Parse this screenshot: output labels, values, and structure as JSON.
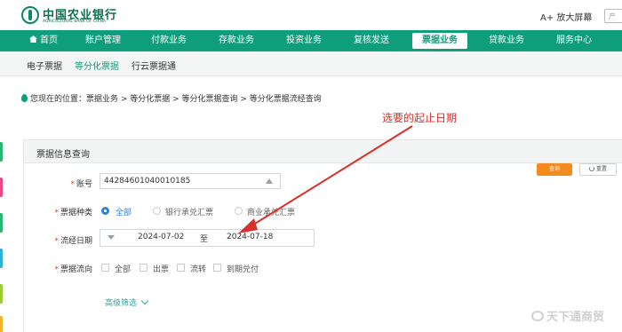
{
  "header": {
    "bank_name_cn": "中国农业银行",
    "bank_name_en": "AGRICULTURAL BANK OF CHINA",
    "zoom_label": "A+ 放大屏幕",
    "search_placeholder": "产"
  },
  "nav": {
    "items": [
      {
        "label": "首页"
      },
      {
        "label": "账户管理"
      },
      {
        "label": "付款业务"
      },
      {
        "label": "存款业务"
      },
      {
        "label": "投资业务"
      },
      {
        "label": "复核发送"
      },
      {
        "label": "票据业务"
      },
      {
        "label": "贷款业务"
      },
      {
        "label": "服务中心"
      }
    ],
    "active": "票据业务"
  },
  "subnav": {
    "items": [
      {
        "label": "电子票据"
      },
      {
        "label": "等分化票据"
      },
      {
        "label": "行云票据通"
      }
    ],
    "active": "等分化票据"
  },
  "breadcrumb": "您现在的位置：票据业务 > 等分化票据 > 等分化票据查询 > 等分化票据流经查询",
  "annotation": "选要的起止日期",
  "panel": {
    "title": "票据信息查询",
    "query_button": "查询",
    "reset_button": "重置",
    "account": {
      "label": "账号",
      "value": "44284601040010185"
    },
    "bill_type": {
      "label": "票据种类",
      "options": [
        "全部",
        "银行承兑汇票",
        "商业承兑汇票"
      ],
      "selected": "全部"
    },
    "date_range": {
      "label": "流经日期",
      "start": "2024-07-02",
      "separator": "至",
      "end": "2024-07-18"
    },
    "flow": {
      "label": "票据流向",
      "options": [
        "全部",
        "出票",
        "流转",
        "到期兑付"
      ]
    },
    "advanced_filter": "高级筛选"
  },
  "watermark": "天下通商贸",
  "colors": {
    "brand_green": "#0f9e7c",
    "annotation_red": "#d8302a",
    "query_orange": "#f58a1f",
    "radio_blue": "#2f80d8"
  }
}
